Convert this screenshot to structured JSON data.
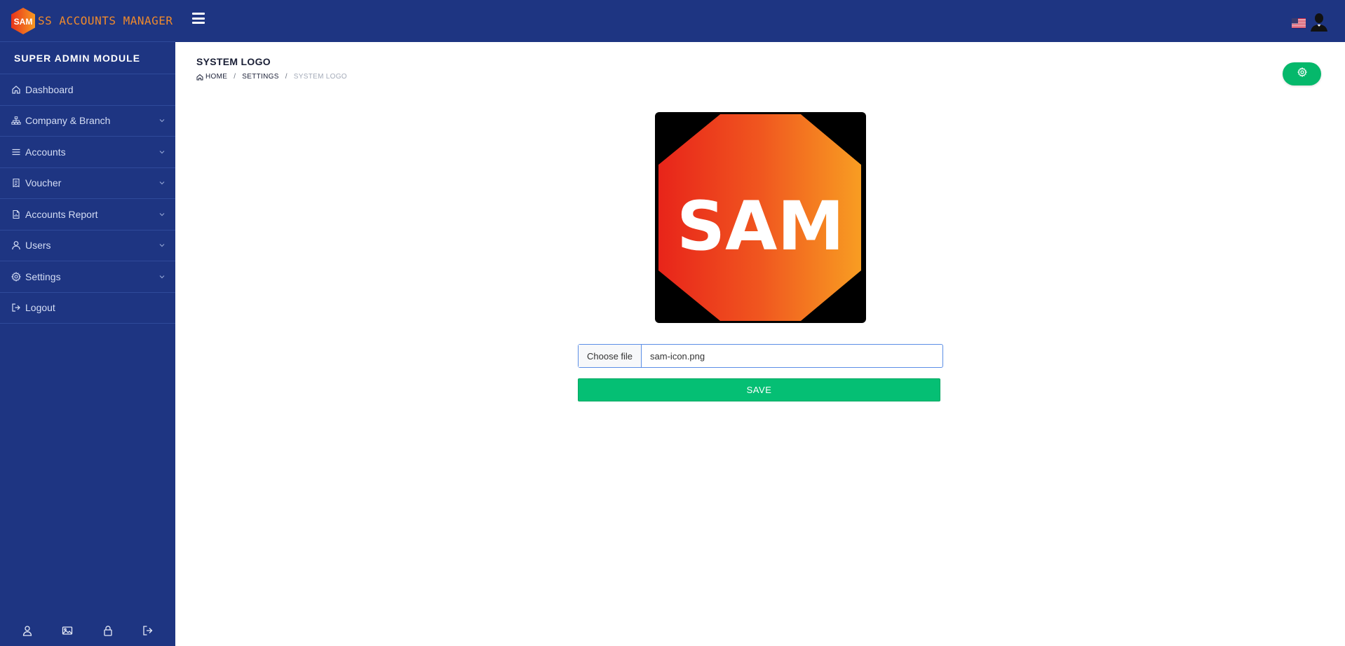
{
  "brand": {
    "logo_text": "SAM",
    "name": "SS ACCOUNTS MANAGER",
    "accent": "#f08a2c"
  },
  "sidebar": {
    "module_title": "SUPER ADMIN MODULE",
    "items": [
      {
        "label": "Dashboard",
        "icon": "home-icon",
        "expandable": false
      },
      {
        "label": "Company & Branch",
        "icon": "sitemap-icon",
        "expandable": true
      },
      {
        "label": "Accounts",
        "icon": "list-icon",
        "expandable": true
      },
      {
        "label": "Voucher",
        "icon": "receipt-icon",
        "expandable": true
      },
      {
        "label": "Accounts Report",
        "icon": "file-report-icon",
        "expandable": true
      },
      {
        "label": "Users",
        "icon": "user-icon",
        "expandable": true
      },
      {
        "label": "Settings",
        "icon": "gear-icon",
        "expandable": true
      },
      {
        "label": "Logout",
        "icon": "logout-icon",
        "expandable": false
      }
    ],
    "footer_icons": [
      "profile-icon",
      "image-icon",
      "lock-icon",
      "logout-icon"
    ],
    "bg_color": "#1e3582"
  },
  "header": {
    "menu_icon": "hamburger-icon",
    "language_icon": "us-flag-icon",
    "avatar_icon": "user-avatar-icon"
  },
  "page": {
    "title": "SYSTEM LOGO",
    "breadcrumb": {
      "home": "HOME",
      "settings": "SETTINGS",
      "current": "SYSTEM LOGO"
    },
    "settings_button_icon": "gear-icon",
    "accent": "#05b86b"
  },
  "logo_preview": {
    "text": "SAM"
  },
  "upload": {
    "button_label": "Choose file",
    "file_name": "sam-icon.png"
  },
  "save": {
    "label": "SAVE"
  }
}
